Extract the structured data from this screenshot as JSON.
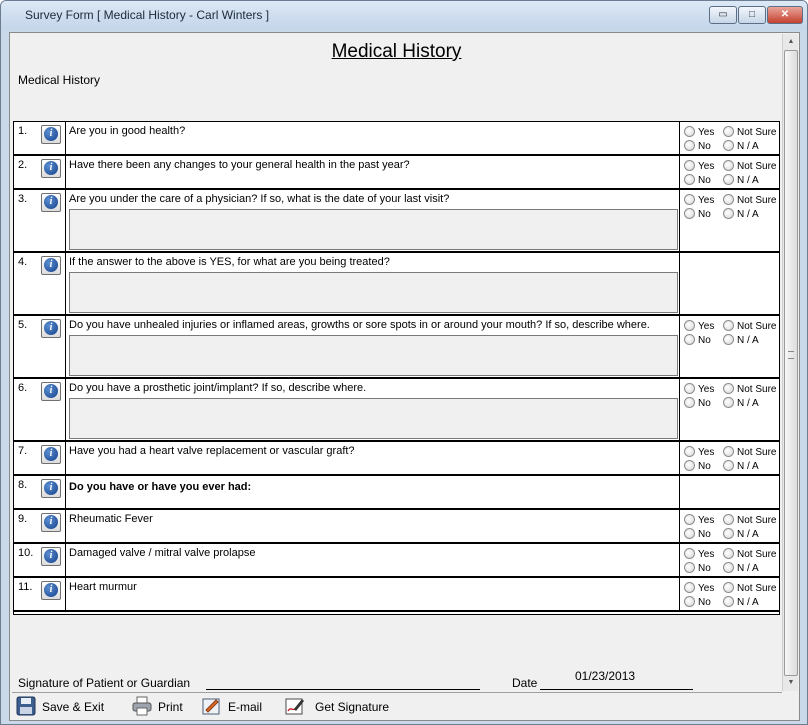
{
  "window": {
    "title": "Survey Form [ Medical History - Carl Winters ]",
    "controls": {
      "minimize": "▭",
      "maximize": "□",
      "close": "✕"
    }
  },
  "form": {
    "heading": "Medical History",
    "subheading": "Medical History"
  },
  "answer_labels": {
    "yes": "Yes",
    "no": "No",
    "not_sure": "Not Sure",
    "na": "N / A"
  },
  "questions": [
    {
      "number": "1.",
      "text": "Are you in good health?"
    },
    {
      "number": "2.",
      "text": "Have there been any changes to your general health in the past year?"
    },
    {
      "number": "3.",
      "text": "Are you under the care of a physician? If so, what is the date of your last visit?"
    },
    {
      "number": "4.",
      "text": "If the answer to the above is YES, for what are you being treated?"
    },
    {
      "number": "5.",
      "text": "Do you have unhealed injuries or inflamed areas, growths or sore spots in or around your mouth? If so, describe where."
    },
    {
      "number": "6.",
      "text": "Do you have a prosthetic joint/implant? If so, describe where."
    },
    {
      "number": "7.",
      "text": "Have you had a heart valve replacement or vascular graft?"
    },
    {
      "number": "8.",
      "text": "Do you have or have you ever had:"
    },
    {
      "number": "9.",
      "text": "Rheumatic Fever"
    },
    {
      "number": "10.",
      "text": "Damaged valve / mitral valve prolapse"
    },
    {
      "number": "11.",
      "text": "Heart murmur"
    }
  ],
  "footer": {
    "signature_label": "Signature of Patient or Guardian",
    "date_label": "Date",
    "date_value": "01/23/2013"
  },
  "toolbar": {
    "save_exit": "Save & Exit",
    "print": "Print",
    "email": "E-mail",
    "get_signature": "Get Signature"
  },
  "icons": {
    "info": "info-icon",
    "save": "floppy-disk-icon",
    "print": "printer-icon",
    "email": "email-edit-icon",
    "signature": "signature-pen-icon"
  },
  "colors": {
    "titlebar": "#c4d6ea",
    "window_bg": "#f0f0f0",
    "info_icon": "#14408c",
    "close_button": "#c4402f"
  }
}
